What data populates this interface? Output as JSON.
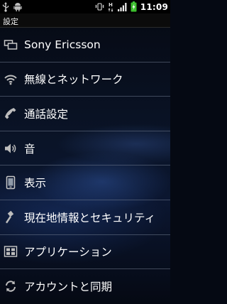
{
  "status_bar": {
    "time": "11:09",
    "left_icons": [
      "usb-icon",
      "android-debug-icon"
    ],
    "right_icons": [
      "vibrate-icon",
      "hspa-icon",
      "signal-icon",
      "battery-charging-icon"
    ]
  },
  "title": "設定",
  "menu": {
    "items": [
      {
        "label": "Sony Ericsson",
        "icon": "windows-icon"
      },
      {
        "label": "無線とネットワーク",
        "icon": "wifi-icon"
      },
      {
        "label": "通話設定",
        "icon": "phone-handset-icon"
      },
      {
        "label": "音",
        "icon": "speaker-icon"
      },
      {
        "label": "表示",
        "icon": "display-icon"
      },
      {
        "label": "現在地情報とセキュリティ",
        "icon": "security-icon"
      },
      {
        "label": "アプリケーション",
        "icon": "applications-icon"
      },
      {
        "label": "アカウントと同期",
        "icon": "sync-icon"
      }
    ]
  }
}
